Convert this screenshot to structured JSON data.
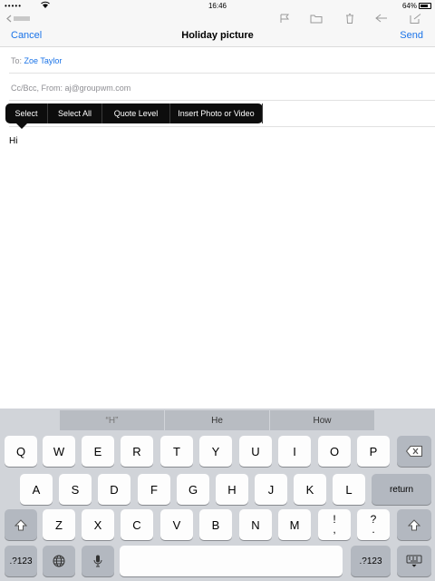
{
  "status_bar": {
    "carrier": "•••••",
    "time": "16:46",
    "battery": "64%"
  },
  "behind_toolbar": {
    "back_label": "Inbox"
  },
  "compose": {
    "cancel_label": "Cancel",
    "title": "Holiday picture",
    "send_label": "Send",
    "to_label": "To:",
    "to_recipient": "Zoe Taylor",
    "cc_label": "Cc/Bcc, From:",
    "from_address": "aj@groupwm.com",
    "body_text": "Hi"
  },
  "edit_menu": {
    "items": [
      "Select",
      "Select All",
      "Quote Level",
      "Insert Photo or Video"
    ]
  },
  "keyboard": {
    "suggestions": [
      "“H”",
      "He",
      "How"
    ],
    "row1": [
      "Q",
      "W",
      "E",
      "R",
      "T",
      "Y",
      "U",
      "I",
      "O",
      "P"
    ],
    "row2": [
      "A",
      "S",
      "D",
      "F",
      "G",
      "H",
      "J",
      "K",
      "L"
    ],
    "row3": [
      "Z",
      "X",
      "C",
      "V",
      "B",
      "N",
      "M"
    ],
    "row3_punct": [
      [
        "!",
        ","
      ],
      [
        "?",
        "."
      ]
    ],
    "return_label": "return",
    "numbers_label": ".?123"
  },
  "colors": {
    "accent": "#1a73e8",
    "menu_bg": "#0d0d0d",
    "keyboard_bg": "#d1d4d9"
  },
  "icons": [
    "wifi-icon",
    "battery-icon",
    "back-chevron-icon",
    "flag-icon",
    "folder-icon",
    "trash-icon",
    "reply-icon",
    "compose-icon",
    "backspace-icon",
    "shift-icon",
    "globe-icon",
    "microphone-icon",
    "keyboard-dismiss-icon"
  ]
}
